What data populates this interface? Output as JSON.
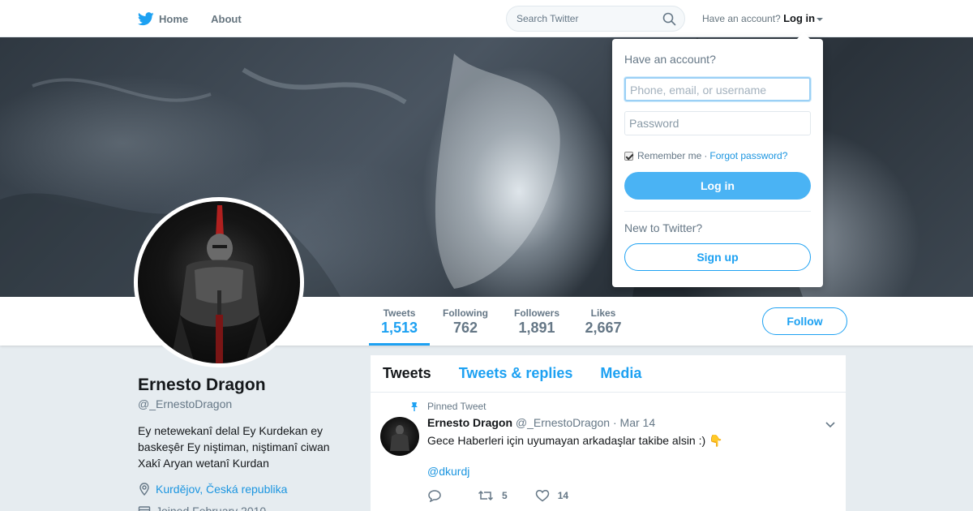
{
  "nav": {
    "home_label": "Home",
    "about_label": "About",
    "search_placeholder": "Search Twitter",
    "have_account": "Have an account?",
    "login_label": "Log in",
    "brand_color": "#1da1f2"
  },
  "login_dropdown": {
    "title": "Have an account?",
    "username_placeholder": "Phone, email, or username",
    "password_placeholder": "Password",
    "remember_label": "Remember me",
    "separator": "·",
    "forgot_label": "Forgot password?",
    "login_button": "Log in",
    "new_to": "New to Twitter?",
    "signup_button": "Sign up"
  },
  "stats": [
    {
      "label": "Tweets",
      "value": "1,513"
    },
    {
      "label": "Following",
      "value": "762"
    },
    {
      "label": "Followers",
      "value": "1,891"
    },
    {
      "label": "Likes",
      "value": "2,667"
    }
  ],
  "follow_button": "Follow",
  "profile": {
    "name": "Ernesto Dragon",
    "handle": "@_ErnestoDragon",
    "bio_line1": "Ey netewekanî delal Ey Kurdekan ey",
    "bio_line2": "baskeşêr  Ey niştiman, niştimanî ciwan",
    "bio_line3": "Xakî Aryan wetanî Kurdan",
    "location": "Kurdějov, Česká republika",
    "joined": "Joined February 2010"
  },
  "timeline": {
    "tabs": [
      "Tweets",
      "Tweets & replies",
      "Media"
    ],
    "tweet": {
      "pinned_label": "Pinned Tweet",
      "name": "Ernesto Dragon",
      "handle": "@_ErnestoDragon",
      "dot": "·",
      "date": "Mar 14",
      "text": "Gece Haberleri için uyumayan arkadaşlar takibe alsin :)",
      "emoji": "👇",
      "link": "@dkurdj",
      "retweets": "5",
      "likes": "14"
    }
  }
}
